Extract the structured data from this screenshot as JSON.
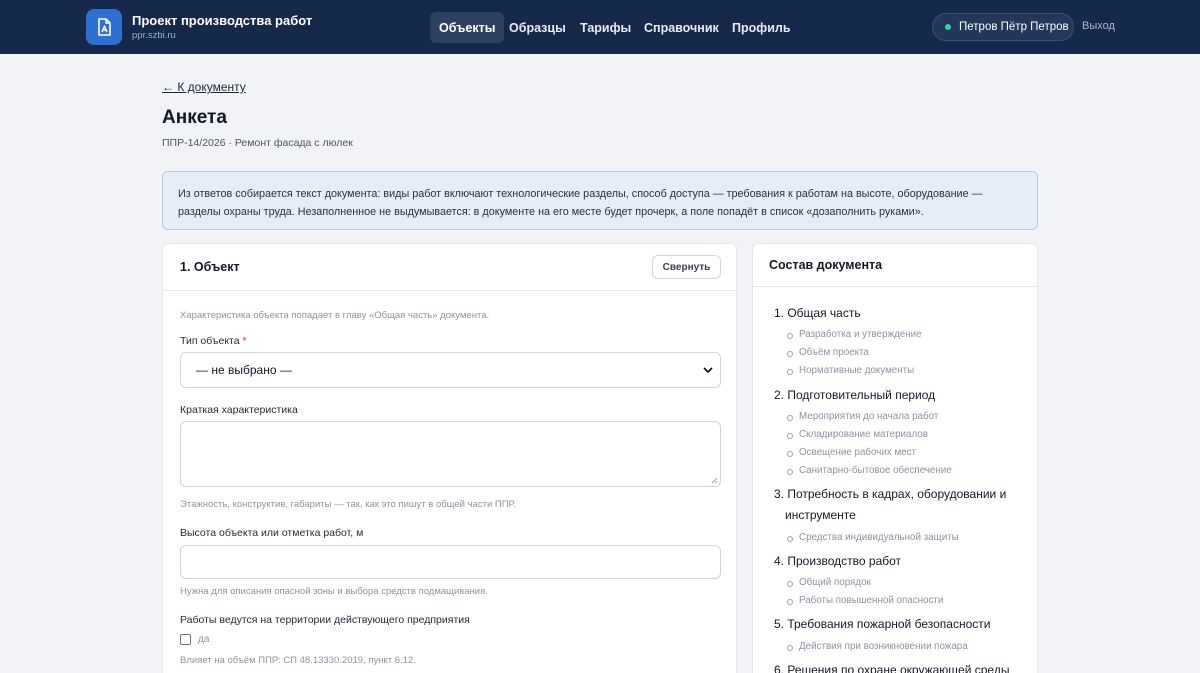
{
  "header": {
    "app_title": "Проект производства работ",
    "app_domain": "ppr.szbi.ru",
    "nav": [
      "Объекты",
      "Образцы",
      "Тарифы",
      "Справочник",
      "Профиль"
    ],
    "active_nav": "Объекты",
    "user_name": "Петров Пётр Петров",
    "logout_label": "Выход"
  },
  "page": {
    "back_link": "← К документу",
    "title": "Анкета",
    "subtitle": "ППР-14/2026 · Ремонт фасада с люлек",
    "info_text": "Из ответов собирается текст документа: виды работ включают технологические разделы, способ доступа — требования к работам на высоте, оборудование — разделы охраны труда. Незаполненное не выдумывается: в документе на его месте будет прочерк, а поле попадёт в список «дозаполнить руками»."
  },
  "form": {
    "section_title": "1. Объект",
    "collapse_label": "Свернуть",
    "section_hint": "Характеристика объекта попадает в главу «Общая часть» документа.",
    "object_type_label": "Тип объекта",
    "object_type_required": "*",
    "object_type_value": "— не выбрано —",
    "brief_label": "Краткая характеристика",
    "brief_value": "",
    "brief_hint": "Этажность, конструктив, габариты — так, как это пишут в общей части ППР.",
    "height_label": "Высота объекта или отметка работ, м",
    "height_value": "",
    "height_hint": "Нужна для описания опасной зоны и выбора средств подмащивания.",
    "territory_label": "Работы ведутся на территории действующего предприятия",
    "territory_checkbox_label": "да",
    "territory_checked": false,
    "territory_hint": "Влияет на объём ППР: СП 48.13330.2019, пункт 6.12."
  },
  "toc": {
    "title": "Состав документа",
    "sections": [
      {
        "title": "1. Общая часть",
        "items": [
          "Разработка и утверждение",
          "Объём проекта",
          "Нормативные документы"
        ]
      },
      {
        "title": "2. Подготовительный период",
        "items": [
          "Мероприятия до начала работ",
          "Складирование материалов",
          "Освещение рабочих мест",
          "Санитарно-бытовое обеспечение"
        ]
      },
      {
        "title_lines": [
          "3. Потребность в кадрах, оборудовании и",
          "инструменте"
        ],
        "items": [
          "Средства индивидуальной защиты"
        ]
      },
      {
        "title": "4. Производство работ",
        "items": [
          "Общий порядок",
          "Работы повышенной опасности"
        ]
      },
      {
        "title": "5. Требования пожарной безопасности",
        "items": [
          "Действия при возникновении пожара"
        ]
      },
      {
        "title": "6. Решения по охране окружающей среды",
        "items": []
      }
    ]
  },
  "colors": {
    "header_bg": "#17294a",
    "accent": "#2f6fd1",
    "online_dot": "#34d399",
    "required": "#dc2626",
    "info_bg": "#e5edf6"
  },
  "icons": {
    "logo": "document-icon",
    "select": "chevron-down-icon",
    "status": "online-dot-icon"
  }
}
